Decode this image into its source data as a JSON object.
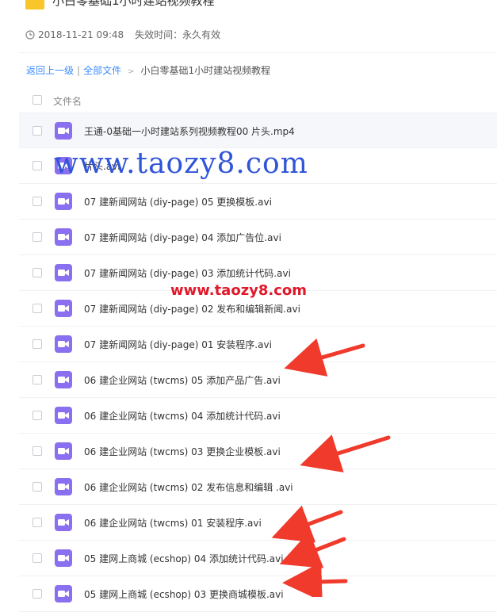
{
  "header": {
    "title": "小白零基础1小时建站视频教程",
    "date": "2018-11-21 09:48",
    "expire": "失效时间：永久有效"
  },
  "breadcrumb": {
    "back": "返回上一级",
    "sep": "|",
    "all_files": "全部文件",
    "gt": ">",
    "current": "小白零基础1小时建站视频教程"
  },
  "list": {
    "column_header": "文件名",
    "files": [
      {
        "name": "王通-0基础一小时建站系列视频教程00 片头.mp4"
      },
      {
        "name": "片头.avi"
      },
      {
        "name": "07 建新闻网站 (diy-page) 05 更换模板.avi"
      },
      {
        "name": "07 建新闻网站 (diy-page) 04 添加广告位.avi"
      },
      {
        "name": "07 建新闻网站 (diy-page) 03 添加统计代码.avi"
      },
      {
        "name": "07 建新闻网站 (diy-page) 02 发布和编辑新闻.avi"
      },
      {
        "name": "07 建新闻网站 (diy-page) 01 安装程序.avi"
      },
      {
        "name": "06 建企业网站 (twcms) 05 添加产品广告.avi"
      },
      {
        "name": "06 建企业网站 (twcms) 04 添加统计代码.avi"
      },
      {
        "name": "06 建企业网站 (twcms) 03 更换企业模板.avi"
      },
      {
        "name": "06 建企业网站 (twcms) 02 发布信息和编辑 .avi"
      },
      {
        "name": "06 建企业网站 (twcms) 01 安装程序.avi"
      },
      {
        "name": "05 建网上商城 (ecshop) 04 添加统计代码.avi"
      },
      {
        "name": "05 建网上商城 (ecshop) 03 更换商城模板.avi"
      }
    ]
  },
  "watermarks": {
    "large": "www.taozy8.com",
    "small": "www.taozy8.com"
  },
  "colors": {
    "accent_link": "#3b8cff",
    "video_icon": "#8a6ff0",
    "folder_icon": "#f9c62a",
    "annotation_red": "#f03a2c"
  }
}
